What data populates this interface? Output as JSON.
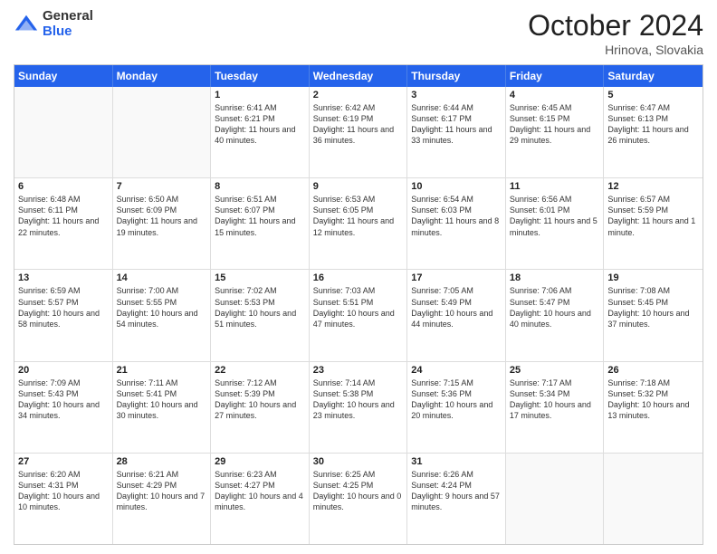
{
  "header": {
    "logo": {
      "general": "General",
      "blue": "Blue"
    },
    "title": "October 2024",
    "subtitle": "Hrinova, Slovakia"
  },
  "days_of_week": [
    "Sunday",
    "Monday",
    "Tuesday",
    "Wednesday",
    "Thursday",
    "Friday",
    "Saturday"
  ],
  "weeks": [
    [
      {
        "day": "",
        "empty": true
      },
      {
        "day": "",
        "empty": true
      },
      {
        "day": "1",
        "sunrise": "Sunrise: 6:41 AM",
        "sunset": "Sunset: 6:21 PM",
        "daylight": "Daylight: 11 hours and 40 minutes."
      },
      {
        "day": "2",
        "sunrise": "Sunrise: 6:42 AM",
        "sunset": "Sunset: 6:19 PM",
        "daylight": "Daylight: 11 hours and 36 minutes."
      },
      {
        "day": "3",
        "sunrise": "Sunrise: 6:44 AM",
        "sunset": "Sunset: 6:17 PM",
        "daylight": "Daylight: 11 hours and 33 minutes."
      },
      {
        "day": "4",
        "sunrise": "Sunrise: 6:45 AM",
        "sunset": "Sunset: 6:15 PM",
        "daylight": "Daylight: 11 hours and 29 minutes."
      },
      {
        "day": "5",
        "sunrise": "Sunrise: 6:47 AM",
        "sunset": "Sunset: 6:13 PM",
        "daylight": "Daylight: 11 hours and 26 minutes."
      }
    ],
    [
      {
        "day": "6",
        "sunrise": "Sunrise: 6:48 AM",
        "sunset": "Sunset: 6:11 PM",
        "daylight": "Daylight: 11 hours and 22 minutes."
      },
      {
        "day": "7",
        "sunrise": "Sunrise: 6:50 AM",
        "sunset": "Sunset: 6:09 PM",
        "daylight": "Daylight: 11 hours and 19 minutes."
      },
      {
        "day": "8",
        "sunrise": "Sunrise: 6:51 AM",
        "sunset": "Sunset: 6:07 PM",
        "daylight": "Daylight: 11 hours and 15 minutes."
      },
      {
        "day": "9",
        "sunrise": "Sunrise: 6:53 AM",
        "sunset": "Sunset: 6:05 PM",
        "daylight": "Daylight: 11 hours and 12 minutes."
      },
      {
        "day": "10",
        "sunrise": "Sunrise: 6:54 AM",
        "sunset": "Sunset: 6:03 PM",
        "daylight": "Daylight: 11 hours and 8 minutes."
      },
      {
        "day": "11",
        "sunrise": "Sunrise: 6:56 AM",
        "sunset": "Sunset: 6:01 PM",
        "daylight": "Daylight: 11 hours and 5 minutes."
      },
      {
        "day": "12",
        "sunrise": "Sunrise: 6:57 AM",
        "sunset": "Sunset: 5:59 PM",
        "daylight": "Daylight: 11 hours and 1 minute."
      }
    ],
    [
      {
        "day": "13",
        "sunrise": "Sunrise: 6:59 AM",
        "sunset": "Sunset: 5:57 PM",
        "daylight": "Daylight: 10 hours and 58 minutes."
      },
      {
        "day": "14",
        "sunrise": "Sunrise: 7:00 AM",
        "sunset": "Sunset: 5:55 PM",
        "daylight": "Daylight: 10 hours and 54 minutes."
      },
      {
        "day": "15",
        "sunrise": "Sunrise: 7:02 AM",
        "sunset": "Sunset: 5:53 PM",
        "daylight": "Daylight: 10 hours and 51 minutes."
      },
      {
        "day": "16",
        "sunrise": "Sunrise: 7:03 AM",
        "sunset": "Sunset: 5:51 PM",
        "daylight": "Daylight: 10 hours and 47 minutes."
      },
      {
        "day": "17",
        "sunrise": "Sunrise: 7:05 AM",
        "sunset": "Sunset: 5:49 PM",
        "daylight": "Daylight: 10 hours and 44 minutes."
      },
      {
        "day": "18",
        "sunrise": "Sunrise: 7:06 AM",
        "sunset": "Sunset: 5:47 PM",
        "daylight": "Daylight: 10 hours and 40 minutes."
      },
      {
        "day": "19",
        "sunrise": "Sunrise: 7:08 AM",
        "sunset": "Sunset: 5:45 PM",
        "daylight": "Daylight: 10 hours and 37 minutes."
      }
    ],
    [
      {
        "day": "20",
        "sunrise": "Sunrise: 7:09 AM",
        "sunset": "Sunset: 5:43 PM",
        "daylight": "Daylight: 10 hours and 34 minutes."
      },
      {
        "day": "21",
        "sunrise": "Sunrise: 7:11 AM",
        "sunset": "Sunset: 5:41 PM",
        "daylight": "Daylight: 10 hours and 30 minutes."
      },
      {
        "day": "22",
        "sunrise": "Sunrise: 7:12 AM",
        "sunset": "Sunset: 5:39 PM",
        "daylight": "Daylight: 10 hours and 27 minutes."
      },
      {
        "day": "23",
        "sunrise": "Sunrise: 7:14 AM",
        "sunset": "Sunset: 5:38 PM",
        "daylight": "Daylight: 10 hours and 23 minutes."
      },
      {
        "day": "24",
        "sunrise": "Sunrise: 7:15 AM",
        "sunset": "Sunset: 5:36 PM",
        "daylight": "Daylight: 10 hours and 20 minutes."
      },
      {
        "day": "25",
        "sunrise": "Sunrise: 7:17 AM",
        "sunset": "Sunset: 5:34 PM",
        "daylight": "Daylight: 10 hours and 17 minutes."
      },
      {
        "day": "26",
        "sunrise": "Sunrise: 7:18 AM",
        "sunset": "Sunset: 5:32 PM",
        "daylight": "Daylight: 10 hours and 13 minutes."
      }
    ],
    [
      {
        "day": "27",
        "sunrise": "Sunrise: 6:20 AM",
        "sunset": "Sunset: 4:31 PM",
        "daylight": "Daylight: 10 hours and 10 minutes."
      },
      {
        "day": "28",
        "sunrise": "Sunrise: 6:21 AM",
        "sunset": "Sunset: 4:29 PM",
        "daylight": "Daylight: 10 hours and 7 minutes."
      },
      {
        "day": "29",
        "sunrise": "Sunrise: 6:23 AM",
        "sunset": "Sunset: 4:27 PM",
        "daylight": "Daylight: 10 hours and 4 minutes."
      },
      {
        "day": "30",
        "sunrise": "Sunrise: 6:25 AM",
        "sunset": "Sunset: 4:25 PM",
        "daylight": "Daylight: 10 hours and 0 minutes."
      },
      {
        "day": "31",
        "sunrise": "Sunrise: 6:26 AM",
        "sunset": "Sunset: 4:24 PM",
        "daylight": "Daylight: 9 hours and 57 minutes."
      },
      {
        "day": "",
        "empty": true
      },
      {
        "day": "",
        "empty": true
      }
    ]
  ]
}
